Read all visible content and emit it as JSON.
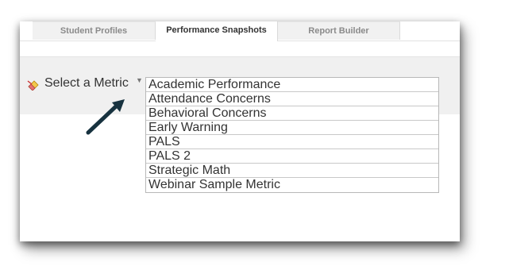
{
  "tabs": [
    {
      "label": "Student Profiles",
      "active": false
    },
    {
      "label": "Performance Snapshots",
      "active": true
    },
    {
      "label": "Report Builder",
      "active": false
    }
  ],
  "metric_selector": {
    "label": "Select a Metric",
    "caret_icon": "caret-down-icon",
    "clear_icon": "eraser-icon",
    "options": [
      "Academic Performance",
      "Attendance Concerns",
      "Behavioral Concerns",
      "Early Warning",
      "PALS",
      "PALS 2",
      "Strategic Math",
      "Webinar Sample Metric"
    ]
  },
  "annotation": {
    "icon": "pointer-arrow-icon",
    "color": "#17323f"
  }
}
